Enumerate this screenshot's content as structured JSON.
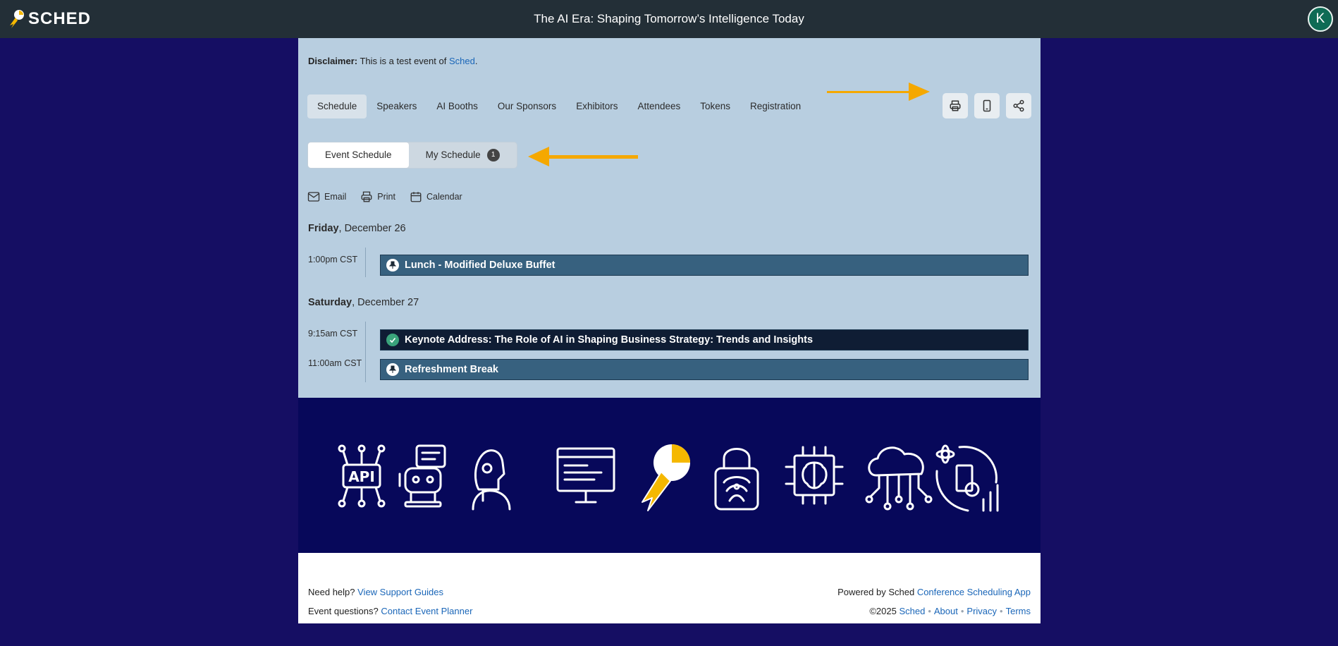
{
  "topbar": {
    "logo_text": "SCHED",
    "title": "The AI Era: Shaping Tomorrow’s Intelligence Today",
    "avatar_initial": "K"
  },
  "disclaimer": {
    "label": "Disclaimer:",
    "text": "This is a test event of",
    "link": "Sched",
    "end": "."
  },
  "nav": {
    "tabs": [
      {
        "label": "Schedule",
        "active": true
      },
      {
        "label": "Speakers"
      },
      {
        "label": "AI Booths"
      },
      {
        "label": "Our Sponsors"
      },
      {
        "label": "Exhibitors"
      },
      {
        "label": "Attendees"
      },
      {
        "label": "Tokens"
      },
      {
        "label": "Registration"
      }
    ],
    "icons": [
      "printer-icon",
      "mobile-icon",
      "share-icon"
    ]
  },
  "views": {
    "event_schedule": "Event Schedule",
    "my_schedule": "My Schedule",
    "my_schedule_count": "1"
  },
  "actions": {
    "email": "Email",
    "print": "Print",
    "calendar": "Calendar"
  },
  "days": [
    {
      "weekday": "Friday",
      "date": ", December 26",
      "sessions": [
        {
          "time": "1:00pm CST",
          "title": "Lunch - Modified Deluxe Buffet",
          "kind": "break"
        }
      ]
    },
    {
      "weekday": "Saturday",
      "date": ", December 27",
      "sessions": [
        {
          "time": "9:15am CST",
          "title": "Keynote Address: The Role of AI in Shaping Business Strategy: Trends and Insights",
          "kind": "added"
        },
        {
          "time": "11:00am CST",
          "title": "Refreshment Break",
          "kind": "break"
        }
      ]
    }
  ],
  "banner": {
    "icons": [
      "api-chip-icon",
      "chatbot-icon",
      "robot-head-icon",
      "code-monitor-icon",
      "sched-logo-icon",
      "fingerprint-lock-icon",
      "brain-chip-icon",
      "cloud-network-icon",
      "data-gear-icon"
    ]
  },
  "footer": {
    "help_text": "Need help?",
    "help_link": "View Support Guides",
    "questions_text": "Event questions?",
    "questions_link": "Contact Event Planner",
    "powered_text": "Powered by Sched",
    "powered_link": "Conference Scheduling App",
    "copyright": "©2025",
    "sched_link": "Sched",
    "about_link": "About",
    "privacy_link": "Privacy",
    "terms_link": "Terms",
    "separator": "•"
  },
  "colors": {
    "page_bg": "#150e63",
    "topbar_bg": "#232f37",
    "panel_bg": "#b8cee0",
    "banner_bg": "#07085a",
    "session_break": "#37617f",
    "session_keynote": "#0f1d34",
    "link": "#1a66b8",
    "arrow": "#f5a800"
  }
}
